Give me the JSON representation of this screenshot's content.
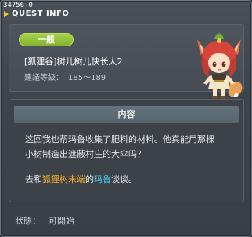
{
  "window": {
    "quest_id": "34756-0",
    "title": "QUEST INFO"
  },
  "header": {
    "badge": "一般",
    "quest_name": "[狐狸谷]树儿树儿快长大2",
    "level_label": "建議等級：",
    "level_range": "185～189",
    "npc_portrait": "fox-girl-npc-portrait"
  },
  "content": {
    "section_title": "内容",
    "description_line1": "这回我也帮玛鲁收集了肥料的材料。他真能用那棵",
    "description_line2": "小树制造出遮蔽村庄的大伞吗？",
    "goto_prefix": "去和",
    "goto_place": "狐狸树末端",
    "goto_middle": "的",
    "goto_npc": "玛鲁",
    "goto_suffix": "谈谈。"
  },
  "status": {
    "label": "狀態：",
    "value": "可開始"
  },
  "colors": {
    "badge_green": "#93c23a",
    "place_orange": "#ffb52b",
    "npc_cyan": "#48c9f0"
  }
}
